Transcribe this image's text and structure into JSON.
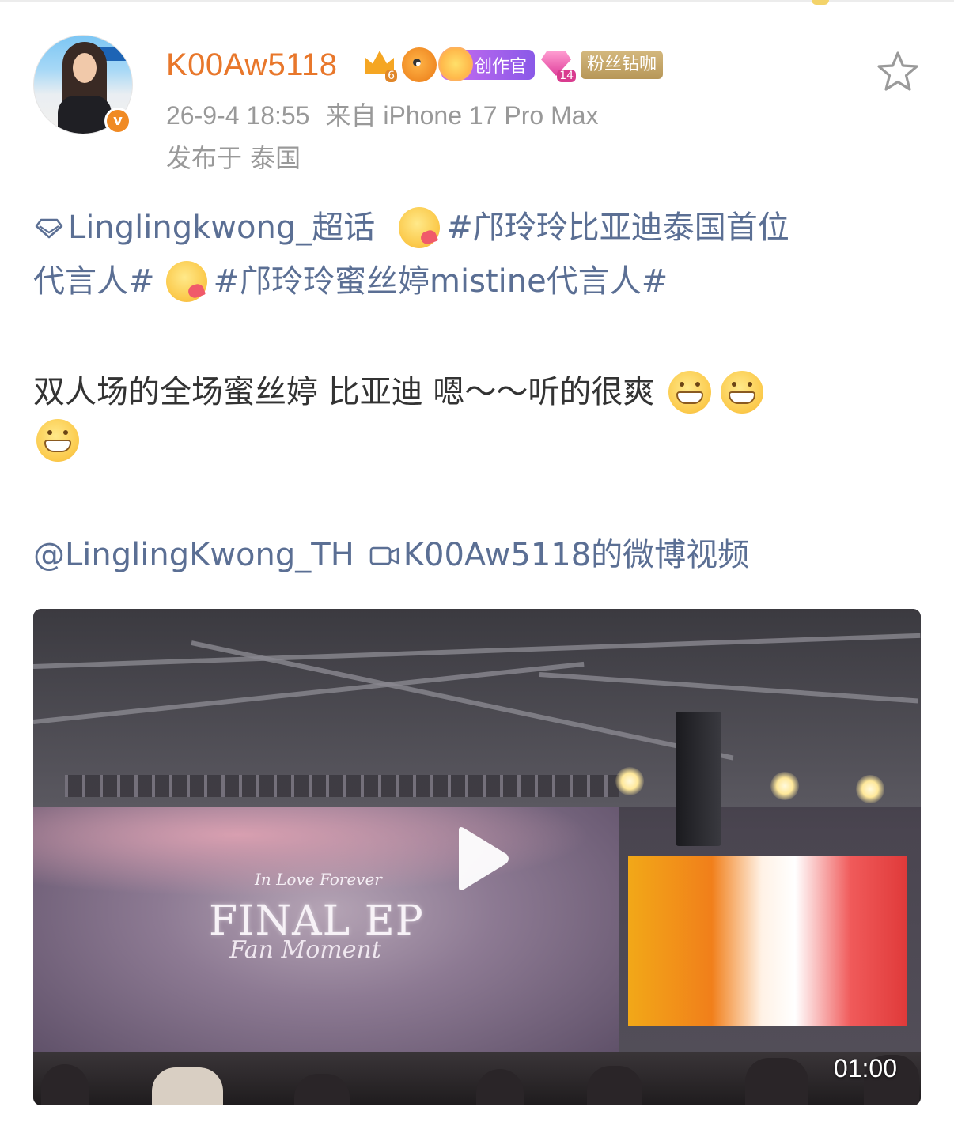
{
  "user": {
    "name": "K00Aw5118",
    "badges": {
      "crown_level": "6",
      "creator_label": "创作官",
      "diamond_level": "14",
      "fan_label": "粉丝钻咖"
    }
  },
  "post": {
    "timestamp": "26-9-4 18:55",
    "source": "来自 iPhone 17 Pro Max",
    "region": "发布于 泰国",
    "supertopic": "Linglingkwong_超话",
    "hashtag1_a": "#邝玲玲比亚迪泰国首位",
    "hashtag1_b": "代言人#",
    "hashtag2": "#邝玲玲蜜丝婷mistine代言人#",
    "body": "双人场的全场蜜丝婷 比亚迪 嗯～～听的很爽",
    "mention": "@LinglingKwong_TH",
    "video_link": "K00Aw5118的微博视频"
  },
  "video": {
    "title_script": "In Love Forever",
    "title_main": "FINAL EP",
    "title_sub": "Fan Moment",
    "duration": "01:00"
  },
  "colors": {
    "username": "#e8772b",
    "link": "#5b6f94",
    "meta": "#999999"
  },
  "icons": [
    "star-icon",
    "verified-icon",
    "crown-badge-icon",
    "fish-badge-icon",
    "creator-badge-icon",
    "diamond-badge-icon",
    "diamond-supertopic-icon",
    "video-link-icon",
    "play-icon",
    "cry-emoji",
    "grin-emoji"
  ]
}
